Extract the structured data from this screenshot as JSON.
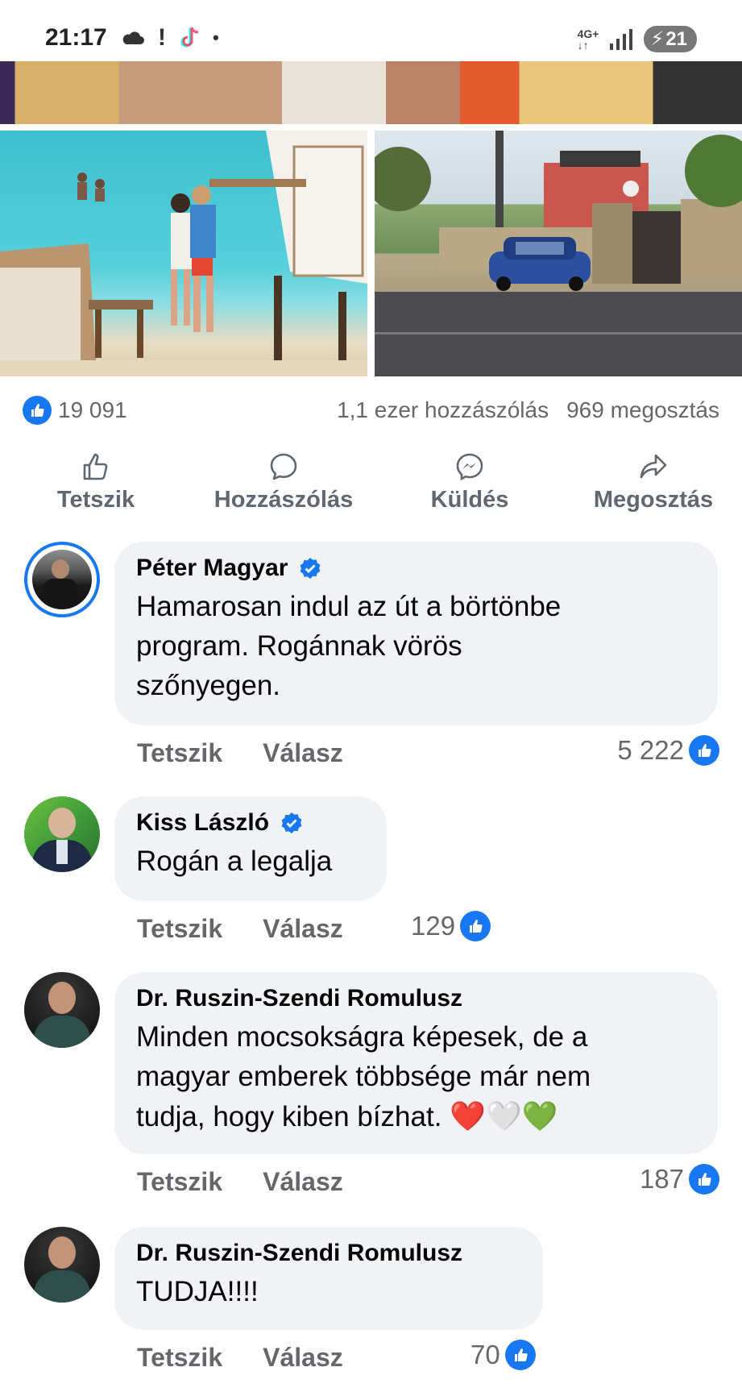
{
  "status_bar": {
    "time": "21:17",
    "left_icons": [
      "cloud-icon",
      "alert-icon",
      "tiktok-icon",
      "dot-icon"
    ],
    "network": "4G+",
    "battery": "21"
  },
  "post_stats": {
    "likes": "19 091",
    "comments": "1,1 ezer hozzászólás",
    "shares": "969 megosztás"
  },
  "actions": {
    "like": "Tetszik",
    "comment": "Hozzászólás",
    "send": "Küldés",
    "share": "Megosztás"
  },
  "comments": [
    {
      "author": "Péter Magyar",
      "verified": true,
      "lines": [
        "Hamarosan indul az út a börtönbe",
        "program. Rogánnak vörös",
        "szőnyegen."
      ],
      "like_label": "Tetszik",
      "reply_label": "Válasz",
      "reactions": "5 222"
    },
    {
      "author": "Kiss László",
      "verified": true,
      "lines": [
        "Rogán a legalja"
      ],
      "like_label": "Tetszik",
      "reply_label": "Válasz",
      "reactions": "129"
    },
    {
      "author": "Dr. Ruszin-Szendi Romulusz",
      "verified": false,
      "lines": [
        "Minden mocsokságra képesek, de a",
        "magyar emberek többsége már nem",
        "tudja, hogy kiben bízhat."
      ],
      "emojis": [
        "❤️",
        "🤍",
        "💚"
      ],
      "like_label": "Tetszik",
      "reply_label": "Válasz",
      "reactions": "187"
    },
    {
      "author": "Dr. Ruszin-Szendi Romulusz",
      "verified": false,
      "lines": [
        "TUDJA!!!!"
      ],
      "like_label": "Tetszik",
      "reply_label": "Válasz",
      "reactions": "70"
    }
  ],
  "colors": {
    "facebook_blue": "#1877f2",
    "bubble_bg": "#f0f2f5",
    "secondary_text": "#65676b"
  }
}
